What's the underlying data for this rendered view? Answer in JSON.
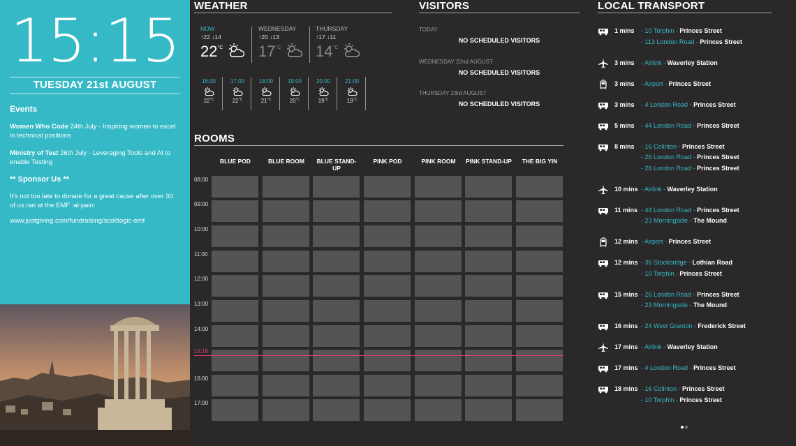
{
  "clock": {
    "time": "15:15",
    "date": "TUESDAY 21st AUGUST"
  },
  "events": {
    "title": "Events",
    "items": [
      {
        "name": "Women Who Code",
        "detail": " 24th July - Inspiring women to excel in technical positions"
      },
      {
        "name": "Ministry of Test",
        "detail": " 26th July - Leveraging Tools and AI to enable Testing"
      }
    ],
    "sponsor_title": "** Sponsor Us **",
    "sponsor_text": "It's not too late to donate for a great cause after over 30 of us ran at the EMF :al-pain:",
    "sponsor_link": "www.justgiving.com/fundraising/scottlogic-emf"
  },
  "weather": {
    "title": "WEATHER",
    "days": [
      {
        "label": "NOW",
        "high": "22",
        "low": "14",
        "temp": "22",
        "unit": "°C",
        "icon": "partly-cloudy-icon"
      },
      {
        "label": "WEDNESDAY",
        "high": "20",
        "low": "13",
        "temp": "17",
        "unit": "°C",
        "icon": "partly-cloudy-icon"
      },
      {
        "label": "THURSDAY",
        "high": "17",
        "low": "11",
        "temp": "14",
        "unit": "°C",
        "icon": "partly-cloudy-icon"
      }
    ],
    "hours": [
      {
        "time": "16:00",
        "temp": "22",
        "unit": "°C"
      },
      {
        "time": "17:00",
        "temp": "22",
        "unit": "°C"
      },
      {
        "time": "18:00",
        "temp": "21",
        "unit": "°C"
      },
      {
        "time": "19:00",
        "temp": "20",
        "unit": "°C"
      },
      {
        "time": "20:00",
        "temp": "19",
        "unit": "°C"
      },
      {
        "time": "21:00",
        "temp": "19",
        "unit": "°C"
      }
    ]
  },
  "visitors": {
    "title": "VISITORS",
    "days": [
      {
        "label": "TODAY",
        "message": "NO SCHEDULED VISITORS"
      },
      {
        "label": "WEDNESDAY 22nd AUGUST",
        "message": "NO SCHEDULED VISITORS"
      },
      {
        "label": "THURSDAY 23rd AUGUST",
        "message": "NO SCHEDULED VISITORS"
      }
    ]
  },
  "rooms": {
    "title": "ROOMS",
    "names": [
      "BLUE POD",
      "BLUE ROOM",
      "BLUE STAND-UP",
      "PINK POD",
      "PINK ROOM",
      "PINK STAND-UP",
      "THE BIG YIN"
    ],
    "times": [
      "08:00",
      "09:00",
      "10:00",
      "11:00",
      "12:00",
      "13:00",
      "14:00",
      "15:15",
      "16:00",
      "17:00"
    ],
    "current_time": "15:15"
  },
  "transport": {
    "title": "LOCAL TRANSPORT",
    "items": [
      {
        "type": "bus",
        "mins": "1 mins",
        "lines": [
          {
            "route": "10 Torphin",
            "dest": "Princes Street"
          },
          {
            "route": "113 London Road",
            "dest": "Princes Street"
          }
        ]
      },
      {
        "type": "plane",
        "mins": "3 mins",
        "lines": [
          {
            "route": "Airlink",
            "dest": "Waverley Station"
          }
        ]
      },
      {
        "type": "tram",
        "mins": "3 mins",
        "lines": [
          {
            "route": "Airport",
            "dest": "Princes Street"
          }
        ]
      },
      {
        "type": "bus",
        "mins": "3 mins",
        "lines": [
          {
            "route": "4 London Road",
            "dest": "Princes Street"
          }
        ]
      },
      {
        "type": "bus",
        "mins": "5 mins",
        "lines": [
          {
            "route": "44 London Road",
            "dest": "Princes Street"
          }
        ]
      },
      {
        "type": "bus",
        "mins": "8 mins",
        "lines": [
          {
            "route": "16 Colinton",
            "dest": "Princes Street"
          },
          {
            "route": "26 London Road",
            "dest": "Princes Street"
          },
          {
            "route": "26 London Road",
            "dest": "Princes Street"
          }
        ]
      },
      {
        "type": "plane",
        "mins": "10 mins",
        "lines": [
          {
            "route": "Airlink",
            "dest": "Waverley Station"
          }
        ]
      },
      {
        "type": "bus",
        "mins": "11 mins",
        "lines": [
          {
            "route": "44 London Road",
            "dest": "Princes Street"
          },
          {
            "route": "23 Morningside",
            "dest": "The Mound"
          }
        ]
      },
      {
        "type": "tram",
        "mins": "12 mins",
        "lines": [
          {
            "route": "Airport",
            "dest": "Princes Street"
          }
        ]
      },
      {
        "type": "bus",
        "mins": "12 mins",
        "lines": [
          {
            "route": "36 Stockbridge",
            "dest": "Lothian Road"
          },
          {
            "route": "10 Torphin",
            "dest": "Princes Street"
          }
        ]
      },
      {
        "type": "bus",
        "mins": "15 mins",
        "lines": [
          {
            "route": "26 London Road",
            "dest": "Princes Street"
          },
          {
            "route": "23 Morningside",
            "dest": "The Mound"
          }
        ]
      },
      {
        "type": "bus",
        "mins": "16 mins",
        "lines": [
          {
            "route": "24 West Granton",
            "dest": "Frederick Street"
          }
        ]
      },
      {
        "type": "plane",
        "mins": "17 mins",
        "lines": [
          {
            "route": "Airlink",
            "dest": "Waverley Station"
          }
        ]
      },
      {
        "type": "bus",
        "mins": "17 mins",
        "lines": [
          {
            "route": "4 London Road",
            "dest": "Princes Street"
          }
        ]
      },
      {
        "type": "bus",
        "mins": "18 mins",
        "lines": [
          {
            "route": "16 Colinton",
            "dest": "Princes Street"
          },
          {
            "route": "10 Torphin",
            "dest": "Princes Street"
          }
        ]
      }
    ]
  },
  "colors": {
    "accent": "#35b9c6",
    "background": "#2b2829",
    "now_line": "#d9427a",
    "slot": "#555354"
  }
}
